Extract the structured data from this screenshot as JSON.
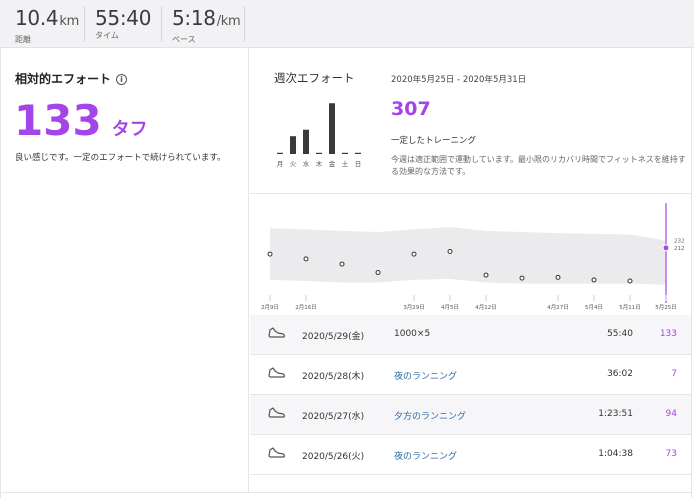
{
  "stats": [
    {
      "value": "10.4",
      "unit": "km",
      "label": "距離"
    },
    {
      "value": "55:40",
      "unit": "",
      "label": "タイム"
    },
    {
      "value": "5:18",
      "unit": "/km",
      "label": "ペース"
    }
  ],
  "relative_effort": {
    "title": "相対的エフォート",
    "info_icon": "info-icon",
    "score": "133",
    "level": "タフ",
    "description": "良い感じです。一定のエフォートで続けられています。"
  },
  "weekly": {
    "title": "週次エフォート",
    "range": "2020年5月25日 - 2020年5月31日",
    "total": "307",
    "subtitle": "一定したトレーニング",
    "description": "今週は適正範囲で運動しています。最小限のリカバリ時間でフィットネスを維持する効果的な方法です。",
    "days": [
      "月",
      "火",
      "水",
      "木",
      "金",
      "土",
      "日"
    ],
    "values": [
      0,
      33,
      45,
      0,
      94,
      0,
      0
    ],
    "bar_color": "#3a3a3a"
  },
  "chart_data": {
    "type": "line",
    "x": [
      "2月9日",
      "2月16日",
      "2月23日",
      "3月1日",
      "4月5日",
      "4月12日",
      "4月19日",
      "4月27日",
      "5月4日",
      "5月11日",
      "5月18日",
      "5月25日"
    ],
    "y": [
      195,
      182,
      168,
      145,
      195,
      202,
      138,
      130,
      132,
      125,
      122,
      212
    ],
    "band_upper": [
      265,
      262,
      258,
      255,
      262,
      268,
      258,
      255,
      252,
      250,
      248,
      232
    ],
    "band_lower": [
      125,
      122,
      118,
      118,
      125,
      128,
      118,
      115,
      115,
      115,
      115,
      112
    ],
    "ylim": [
      95,
      320
    ],
    "x_tick_labels": [
      "2月9日",
      "2月16日",
      "3月29日",
      "4月5日",
      "4月12日",
      "4月27日",
      "5月4日",
      "5月11日",
      "5月25日"
    ],
    "x_tick_index": [
      0,
      1,
      4,
      5,
      6,
      8,
      9,
      10,
      11
    ],
    "y_range_labels": [
      "232",
      "212"
    ],
    "highlight_index": 11,
    "colors": {
      "band": "#ebebed",
      "point": "#333333",
      "highlight": "#a445e8"
    }
  },
  "activities": [
    {
      "date": "2020/5/29(金)",
      "name": "1000×5",
      "link": false,
      "time": "55:40",
      "score": "133"
    },
    {
      "date": "2020/5/28(木)",
      "name": "夜のランニング",
      "link": true,
      "time": "36:02",
      "score": "7"
    },
    {
      "date": "2020/5/27(水)",
      "name": "夕方のランニング",
      "link": true,
      "time": "1:23:51",
      "score": "94"
    },
    {
      "date": "2020/5/26(火)",
      "name": "夜のランニング",
      "link": true,
      "time": "1:04:38",
      "score": "73"
    }
  ],
  "colors": {
    "accent": "#a445e8",
    "link": "#2f6aa8"
  }
}
